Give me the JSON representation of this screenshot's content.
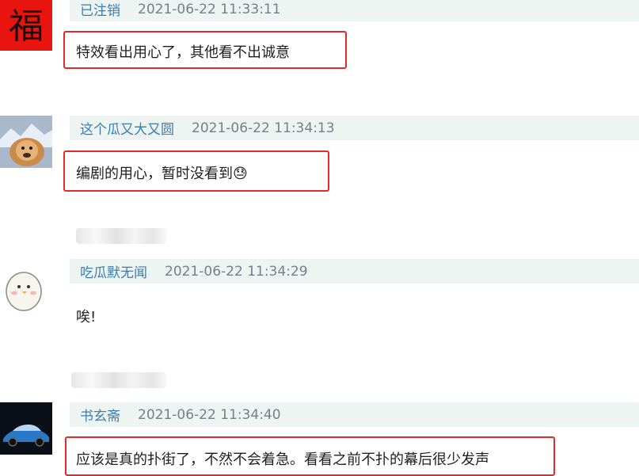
{
  "comments": [
    {
      "user": "已注销",
      "time": "2021-06-22 11:33:11",
      "text": "特效看出用心了，其他看不出诚意",
      "avatar": "calligraphy-avatar",
      "highlighted": true
    },
    {
      "user": "这个瓜又大又圆",
      "time": "2021-06-22 11:34:13",
      "text": "编剧的用心，暂时没看到",
      "emoji": "😓",
      "avatar": "puppy-avatar",
      "highlighted": true
    },
    {
      "user": "吃瓜默无闻",
      "time": "2021-06-22 11:34:29",
      "text": "唉!",
      "avatar": "chick-avatar",
      "highlighted": false
    },
    {
      "user": "书玄斋",
      "time": "2021-06-22 11:34:40",
      "text": "应该是真的扑街了，不然不会着急。看看之前不扑的幕后很少发声",
      "avatar": "car-avatar",
      "highlighted": true
    }
  ],
  "colors": {
    "highlight": "#e32a2a",
    "username": "#3a7fb0",
    "header_bg": "#eef4f2"
  }
}
